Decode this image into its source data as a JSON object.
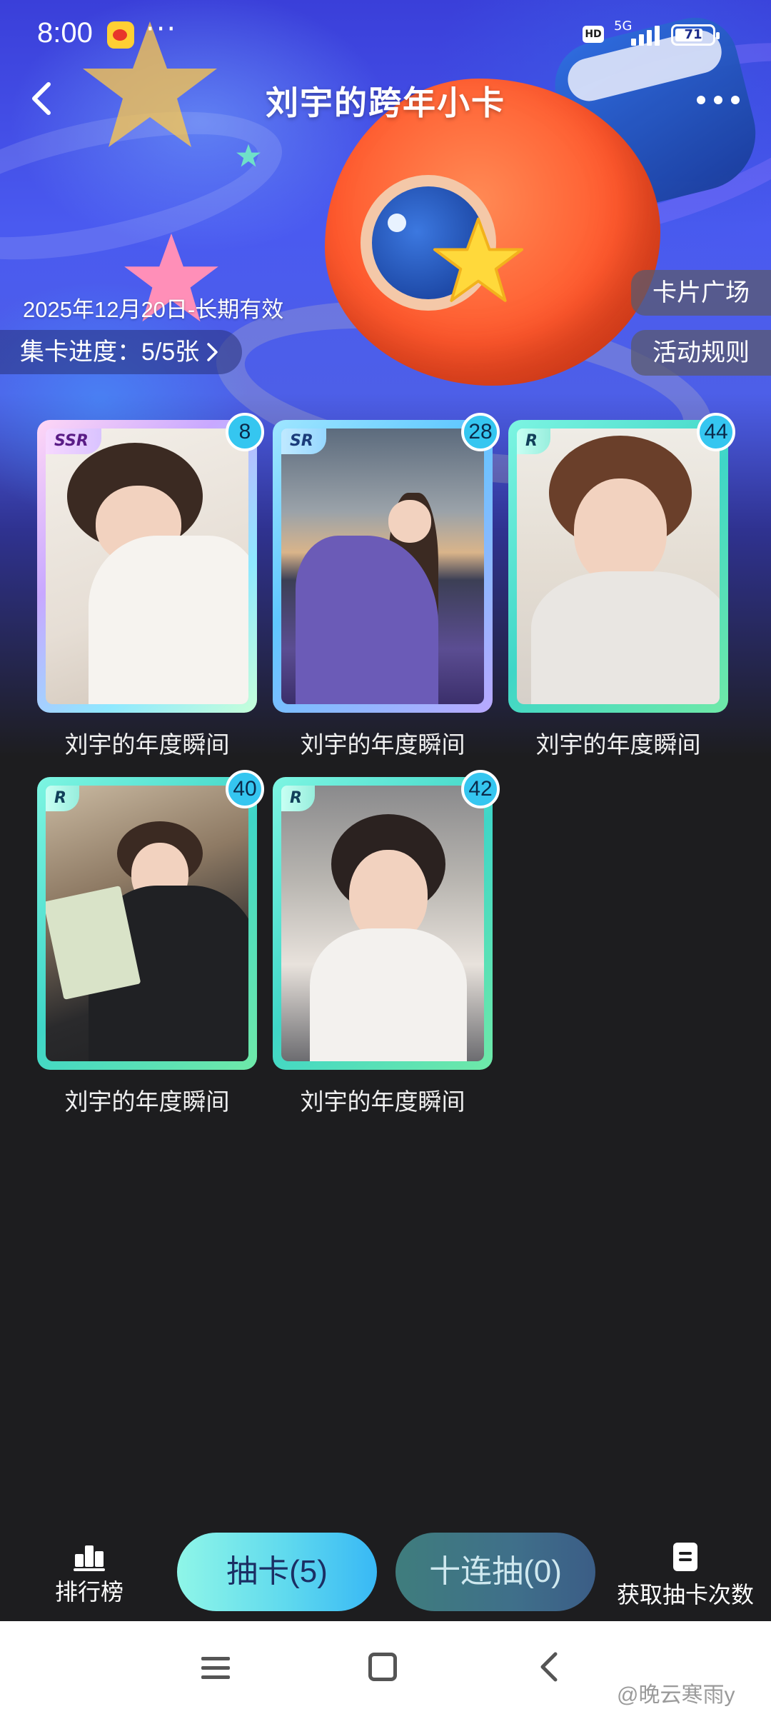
{
  "status_bar": {
    "time": "8:00",
    "network": "5G",
    "hd_badge": "HD",
    "battery": "71"
  },
  "header": {
    "title": "刘宇的跨年小卡"
  },
  "info": {
    "validity": "2025年12月20日-长期有效",
    "progress_label": "集卡进度：5/5张",
    "card_square_button": "卡片广场",
    "rules_button": "活动规则"
  },
  "cards": [
    {
      "rarity": "SSR",
      "count": "8",
      "name": "刘宇的年度瞬间"
    },
    {
      "rarity": "SR",
      "count": "28",
      "name": "刘宇的年度瞬间"
    },
    {
      "rarity": "R",
      "count": "44",
      "name": "刘宇的年度瞬间"
    },
    {
      "rarity": "R",
      "count": "40",
      "name": "刘宇的年度瞬间"
    },
    {
      "rarity": "R",
      "count": "42",
      "name": "刘宇的年度瞬间"
    }
  ],
  "bottom_bar": {
    "ranking_label": "排行榜",
    "draw_button": "抽卡(5)",
    "ten_draw_button": "十连抽(0)",
    "get_draws_label": "获取抽卡次数"
  },
  "watermark": "@晚云寒雨y",
  "icons": {
    "back": "chevron-left-icon",
    "more": "more-dots-icon",
    "ranking": "bar-chart-icon",
    "get_draws": "document-icon"
  },
  "colors": {
    "draw_button": "#5fd9ee",
    "ten_draw_button": "#3f6f8a",
    "count_badge": "#35c6f0",
    "page_background": "#1d1d1f"
  }
}
